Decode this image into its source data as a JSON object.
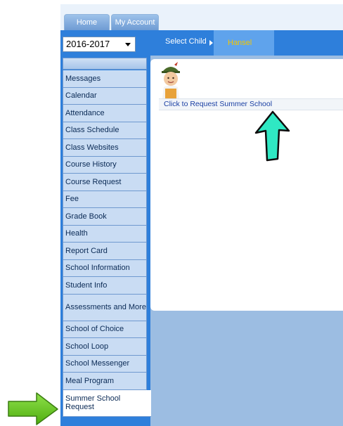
{
  "tabs": [
    {
      "label": "Home"
    },
    {
      "label": "My Account"
    }
  ],
  "year_select": {
    "value": "2016-2017"
  },
  "select_child": {
    "label": "Select Child",
    "child_name": "Hansel"
  },
  "sidebar": {
    "items": [
      {
        "label": "Messages"
      },
      {
        "label": "Calendar"
      },
      {
        "label": "Attendance"
      },
      {
        "label": "Class Schedule"
      },
      {
        "label": "Class Websites"
      },
      {
        "label": "Course History"
      },
      {
        "label": "Course Request"
      },
      {
        "label": "Fee"
      },
      {
        "label": "Grade Book"
      },
      {
        "label": "Health"
      },
      {
        "label": "Report Card"
      },
      {
        "label": "School Information"
      },
      {
        "label": "Student Info"
      },
      {
        "label": "Assessments and More"
      },
      {
        "label": "School of Choice"
      },
      {
        "label": "School Loop"
      },
      {
        "label": "School Messenger"
      },
      {
        "label": "Meal Program"
      },
      {
        "label": "Summer School Request"
      }
    ],
    "active_item": "Summer School Request"
  },
  "main": {
    "request_link": "Click to Request Summer School"
  },
  "icons": {
    "avatar": "student-avatar",
    "caret": "chevron-down-icon",
    "teal_arrow": "arrow-up-icon",
    "green_arrow": "arrow-right-icon"
  },
  "colors": {
    "header_blue": "#2e7fdb",
    "child_name": "#f3c600",
    "teal_arrow": "#2fe8c3",
    "green_arrow": "#66cc1a",
    "link": "#1a3fa3"
  }
}
